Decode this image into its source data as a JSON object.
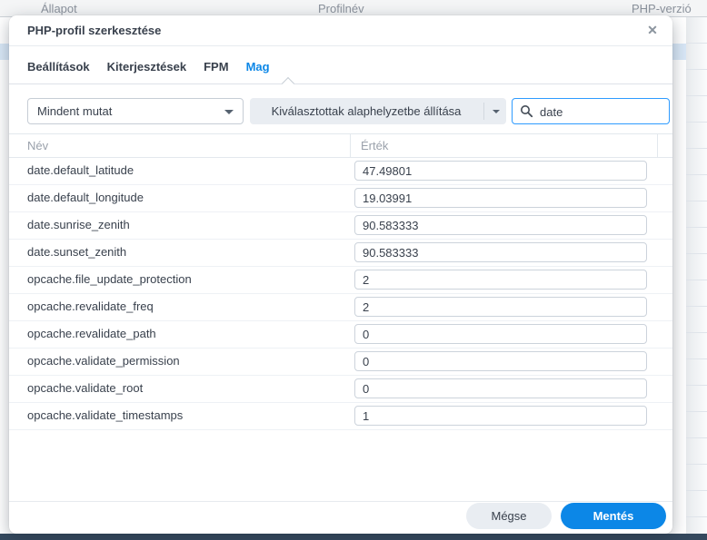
{
  "background": {
    "table_headers": {
      "status": "Állapot",
      "profile_name": "Profilnév",
      "php_version": "PHP-verzió"
    }
  },
  "dialog": {
    "title": "PHP-profil szerkesztése",
    "close_glyph": "✕",
    "tabs": [
      {
        "label": "Beállítások"
      },
      {
        "label": "Kiterjesztések"
      },
      {
        "label": "FPM"
      },
      {
        "label": "Mag"
      }
    ],
    "active_tab": "Mag",
    "toolbar": {
      "filter_selected": "Mindent mutat",
      "reset_button_label": "Kiválasztottak alaphelyzetbe állítása",
      "search_value": "date",
      "search_icon": "magnifier"
    },
    "table": {
      "headers": {
        "name": "Név",
        "value": "Érték"
      },
      "rows": [
        {
          "name": "date.default_latitude",
          "value": "47.49801"
        },
        {
          "name": "date.default_longitude",
          "value": "19.03991"
        },
        {
          "name": "date.sunrise_zenith",
          "value": "90.583333"
        },
        {
          "name": "date.sunset_zenith",
          "value": "90.583333"
        },
        {
          "name": "opcache.file_update_protection",
          "value": "2"
        },
        {
          "name": "opcache.revalidate_freq",
          "value": "2"
        },
        {
          "name": "opcache.revalidate_path",
          "value": "0"
        },
        {
          "name": "opcache.validate_permission",
          "value": "0"
        },
        {
          "name": "opcache.validate_root",
          "value": "0"
        },
        {
          "name": "opcache.validate_timestamps",
          "value": "1"
        }
      ]
    },
    "footer": {
      "cancel_label": "Mégse",
      "save_label": "Mentés"
    }
  },
  "colors": {
    "accent_blue": "#0c87e7",
    "search_focus_border": "#2e9bff",
    "selected_row_blue": "#d9e8f7",
    "bottom_bar_navy": "#35495e"
  }
}
